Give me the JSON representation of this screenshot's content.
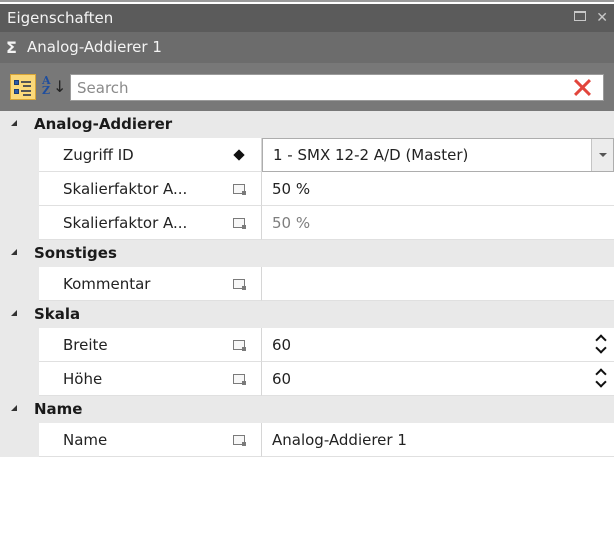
{
  "panel": {
    "title": "Eigenschaften",
    "selected_object": "Analog-Addierer 1",
    "sigma_symbol": "Σ"
  },
  "toolbar": {
    "categorized_icon": "categorized-view-icon",
    "alphabetical_icon": "sort-az-icon",
    "search_placeholder": "Search",
    "search_value": "",
    "clear_icon": "clear-search-icon",
    "categorized_active": true
  },
  "categories": [
    {
      "label": "Analog-Addierer",
      "properties": [
        {
          "name": "Zugriff ID",
          "marker": "diamond-icon",
          "value": "1 - SMX 12-2 A/D (Master)",
          "editor": "dropdown"
        },
        {
          "name": "Skalierfaktor A...",
          "marker": "local-value-icon",
          "value": "50 %",
          "editor": "text"
        },
        {
          "name": "Skalierfaktor A...",
          "marker": "local-value-icon",
          "value": "50 %",
          "editor": "text",
          "dim": true
        }
      ]
    },
    {
      "label": "Sonstiges",
      "properties": [
        {
          "name": "Kommentar",
          "marker": "local-value-icon",
          "value": "",
          "editor": "text"
        }
      ]
    },
    {
      "label": "Skala",
      "properties": [
        {
          "name": "Breite",
          "marker": "local-value-icon",
          "value": "60",
          "editor": "spinner"
        },
        {
          "name": "Höhe",
          "marker": "local-value-icon",
          "value": "60",
          "editor": "spinner"
        }
      ]
    },
    {
      "label": "Name",
      "properties": [
        {
          "name": "Name",
          "marker": "local-value-icon",
          "value": "Analog-Addierer 1",
          "editor": "text"
        }
      ]
    }
  ],
  "colors": {
    "titlebar": "#5b5b5b",
    "objectbar": "#6c6c6c",
    "toolbar": "#787878",
    "category_bg": "#e9e9e9",
    "active_toggle": "#fbd97a",
    "clear_red": "#e2453c"
  }
}
